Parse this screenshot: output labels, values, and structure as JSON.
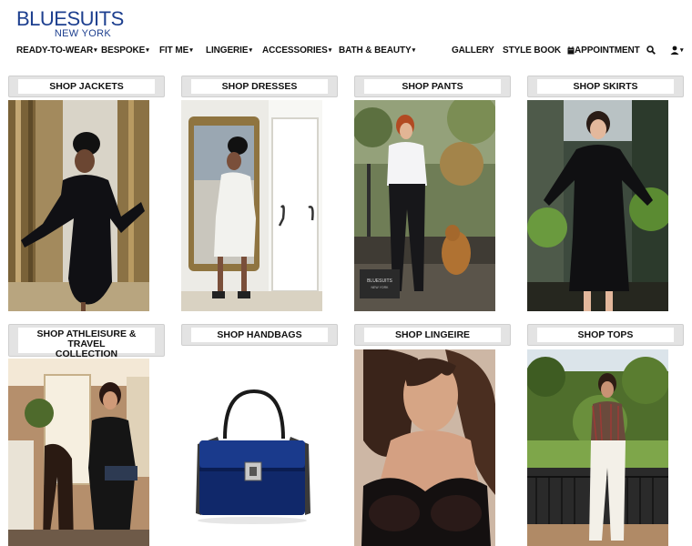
{
  "brand": {
    "name": "BLUESUITS",
    "city": "NEW YORK",
    "color": "#1d3f8f"
  },
  "nav": {
    "ready_to_wear": "READY-TO-WEAR",
    "bespoke": "BESPOKE",
    "fit_me": "FIT ME",
    "lingerie": "LINGERIE",
    "accessories": "ACCESSORIES",
    "bath_beauty": "BATH & BEAUTY",
    "gallery": "GALLERY",
    "style_book": "STYLE BOOK",
    "appointment": "APPOINTMENT",
    "caret": "▾",
    "icons": [
      "calendar-icon",
      "search-icon",
      "user-icon"
    ]
  },
  "tiles": {
    "jackets": "SHOP JACKETS",
    "dresses": "SHOP DRESSES",
    "pants": "SHOP PANTS",
    "skirts": "SHOP SKIRTS",
    "athleisure_line1": "SHOP ATHLEISURE & TRAVEL",
    "athleisure_line2": "COLLECTION",
    "handbags": "SHOP HANDBAGS",
    "lingeire": "SHOP LINGEIRE",
    "tops": "SHOP TOPS"
  },
  "photo_watermark": {
    "name": "BLUESUITS",
    "city": "NEW YORK"
  }
}
